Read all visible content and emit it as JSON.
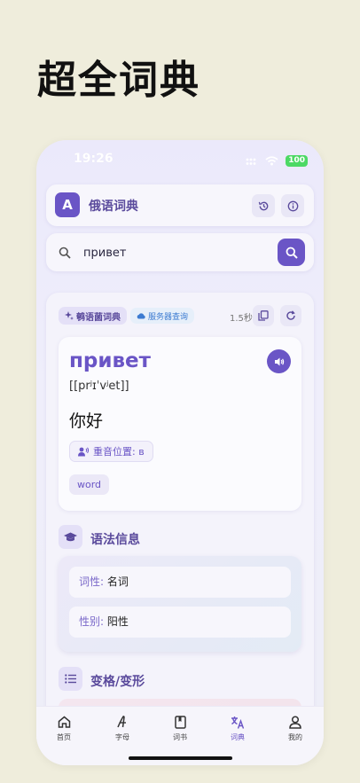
{
  "headline": "超全词典",
  "status": {
    "time": "19:26",
    "battery": "100"
  },
  "appbar": {
    "logo_letter": "A",
    "title": "俄语词典"
  },
  "search": {
    "query": "привет"
  },
  "result": {
    "source_label": "鹌语菌词典",
    "server_label": "服务器查询",
    "timing": "1.5秒",
    "word": "привет",
    "ipa": "[[prʲɪˈvʲet]]",
    "translation": "你好",
    "stress": "重音位置: в",
    "tag": "word"
  },
  "grammar": {
    "title": "语法信息",
    "rows": [
      {
        "key": "词性:",
        "value": "名词"
      },
      {
        "key": "性别:",
        "value": "阳性"
      }
    ]
  },
  "declension": {
    "title": "变格/变形"
  },
  "tabbar": {
    "items": [
      {
        "label": "首页",
        "icon": "home-icon"
      },
      {
        "label": "字母",
        "icon": "alphabet-icon"
      },
      {
        "label": "词书",
        "icon": "book-icon"
      },
      {
        "label": "词典",
        "icon": "translate-icon"
      },
      {
        "label": "我的",
        "icon": "profile-icon"
      }
    ],
    "active": "词典"
  },
  "colors": {
    "accent": "#6a55c6",
    "background": "#efeddc",
    "battery": "#4cd964"
  }
}
